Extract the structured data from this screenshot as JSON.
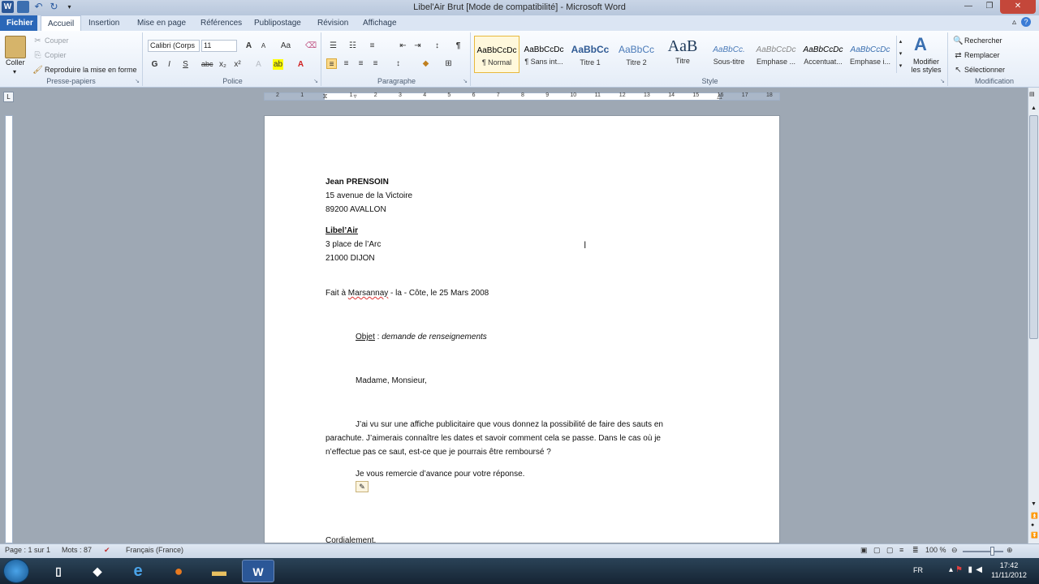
{
  "window": {
    "title": "Libel'Air Brut [Mode de compatibilité] - Microsoft Word"
  },
  "tabs": [
    "Fichier",
    "Accueil",
    "Insertion",
    "Mise en page",
    "Références",
    "Publipostage",
    "Révision",
    "Affichage"
  ],
  "ribbon": {
    "clipboard": {
      "label": "Presse-papiers",
      "paste": "Coller",
      "cut": "Couper",
      "copy": "Copier",
      "format_painter": "Reproduire la mise en forme"
    },
    "font": {
      "label": "Police",
      "font_name": "Calibri (Corps",
      "font_size": "11",
      "bold": "G",
      "italic": "I",
      "underline": "S"
    },
    "paragraph": {
      "label": "Paragraphe"
    },
    "styles": {
      "label": "Style",
      "items": [
        {
          "sample": "AaBbCcDc",
          "name": "¶ Normal"
        },
        {
          "sample": "AaBbCcDc",
          "name": "¶ Sans int..."
        },
        {
          "sample": "AaBbCc",
          "name": "Titre 1"
        },
        {
          "sample": "AaBbCc",
          "name": "Titre 2"
        },
        {
          "sample": "AaB",
          "name": "Titre"
        },
        {
          "sample": "AaBbCc.",
          "name": "Sous-titre"
        },
        {
          "sample": "AaBbCcDc",
          "name": "Emphase ..."
        },
        {
          "sample": "AaBbCcDc",
          "name": "Accentuat..."
        },
        {
          "sample": "AaBbCcDc",
          "name": "Emphase i..."
        }
      ],
      "change_styles": "Modifier les styles"
    },
    "editing": {
      "label": "Modification",
      "find": "Rechercher",
      "replace": "Remplacer",
      "select": "Sélectionner"
    }
  },
  "document": {
    "sender_name": "Jean PRENSOIN",
    "sender_street": "15 avenue de la Victoire",
    "sender_city": "89200  AVALLON",
    "recipient_name": "Libel’Air",
    "recipient_street": "3 place de l’Arc",
    "recipient_city": "21000  DIJON",
    "place_date_prefix": "Fait à ",
    "place_name": "Marsannay",
    "place_date_suffix": " - la - Côte, le 25 Mars 2008",
    "object_label": "Objet",
    "object_sep": " : ",
    "object_text": "demande de renseignements",
    "greeting": "Madame, Monsieur,",
    "body_line1": "J’ai vu sur une affiche publicitaire que vous donnez la possibilité de faire des sauts en",
    "body_line2": "parachute. J’aimerais connaître les dates et savoir comment cela se passe. Dans le cas où je",
    "body_line3": "n’effectue pas ce saut, est-ce que je pourrais être remboursé ?",
    "thanks": "Je vous remercie d’avance pour votre réponse.",
    "closing": "Cordialement."
  },
  "statusbar": {
    "page": "Page : 1 sur 1",
    "words": "Mots : 87",
    "language": "Français (France)",
    "zoom": "100 %"
  },
  "taskbar": {
    "lang": "FR",
    "time": "17:42",
    "date": "11/11/2012"
  },
  "colors": {
    "file_tab": "#2a67b8",
    "selected_style": "#e8b93c",
    "font_color": "#d02020",
    "highlight": "#ffff00"
  }
}
